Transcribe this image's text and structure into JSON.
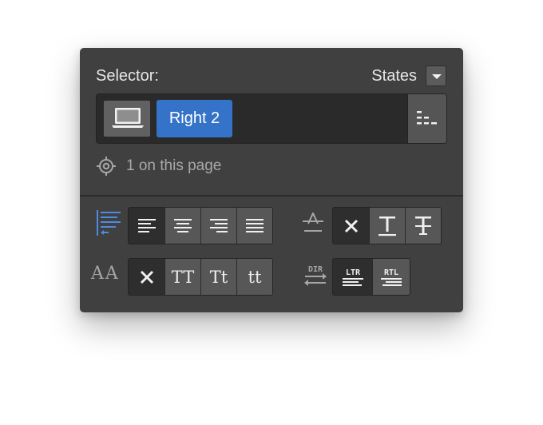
{
  "header": {
    "selector_label": "Selector:",
    "states_label": "States"
  },
  "selector": {
    "device_icon": "laptop-icon",
    "chip_label": "Right 2",
    "list_icon": "selector-list-icon"
  },
  "usage": {
    "icon": "target-icon",
    "text": "1 on this page"
  },
  "text_align": {
    "icon": "text-align-icon",
    "options": [
      "align-left",
      "align-center",
      "align-right",
      "align-justify"
    ],
    "selected": "align-left"
  },
  "text_decoration": {
    "icon": "text-decoration-icon",
    "options": [
      "none",
      "underline",
      "strikethrough"
    ],
    "selected": "none"
  },
  "text_transform": {
    "label": "AA",
    "options": [
      "none",
      "TT",
      "Tt",
      "tt"
    ],
    "selected": "none"
  },
  "direction": {
    "icon_label": "DIR",
    "options": [
      "LTR",
      "RTL"
    ],
    "selected": "LTR"
  },
  "colors": {
    "panel": "#404040",
    "accent": "#3573c9",
    "active_segment": "#2e2e2e",
    "segment": "#575757"
  }
}
